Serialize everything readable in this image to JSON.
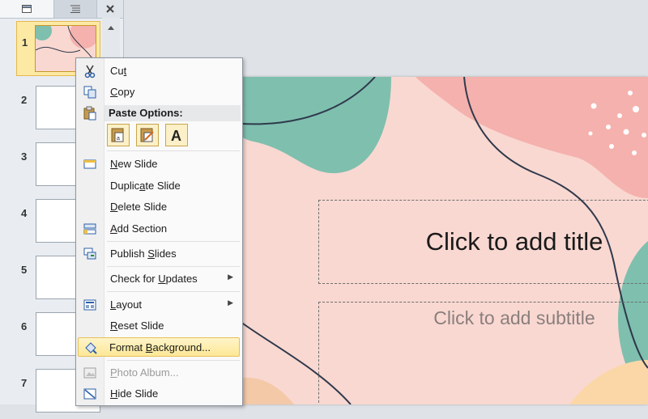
{
  "slide_panel": {
    "thumbnails": [
      {
        "number": "1",
        "selected": true
      },
      {
        "number": "2",
        "selected": false
      },
      {
        "number": "3",
        "selected": false
      },
      {
        "number": "4",
        "selected": false
      },
      {
        "number": "5",
        "selected": false
      },
      {
        "number": "6",
        "selected": false
      },
      {
        "number": "7",
        "selected": false
      }
    ]
  },
  "slide": {
    "title_placeholder": "Click to add title",
    "subtitle_placeholder": "Click to add subtitle",
    "colors": {
      "background": "#f9d8d1",
      "teal": "#7fbfae",
      "pink": "#f5b1ad",
      "peach": "#fbd7a8",
      "line": "#2f3a4c"
    }
  },
  "context_menu": {
    "cut": {
      "pre": "Cu",
      "key": "t",
      "post": ""
    },
    "copy": {
      "pre": "",
      "key": "C",
      "post": "opy"
    },
    "paste_options": "Paste Options:",
    "new_slide": {
      "pre": "",
      "key": "N",
      "post": "ew Slide"
    },
    "duplicate_slide": {
      "pre": "Duplic",
      "key": "a",
      "post": "te Slide"
    },
    "delete_slide": {
      "pre": "",
      "key": "D",
      "post": "elete Slide"
    },
    "add_section": {
      "pre": "",
      "key": "A",
      "post": "dd Section"
    },
    "publish_slides": {
      "pre": "Publish ",
      "key": "S",
      "post": "lides"
    },
    "check_updates": {
      "pre": "Check for ",
      "key": "U",
      "post": "pdates"
    },
    "layout": {
      "pre": "",
      "key": "L",
      "post": "ayout"
    },
    "reset_slide": {
      "pre": "",
      "key": "R",
      "post": "eset Slide"
    },
    "format_background": {
      "pre": "Format ",
      "key": "B",
      "post": "ackground..."
    },
    "photo_album": {
      "pre": "",
      "key": "P",
      "post": "hoto Album..."
    },
    "hide_slide": {
      "pre": "",
      "key": "H",
      "post": "ide Slide"
    }
  }
}
